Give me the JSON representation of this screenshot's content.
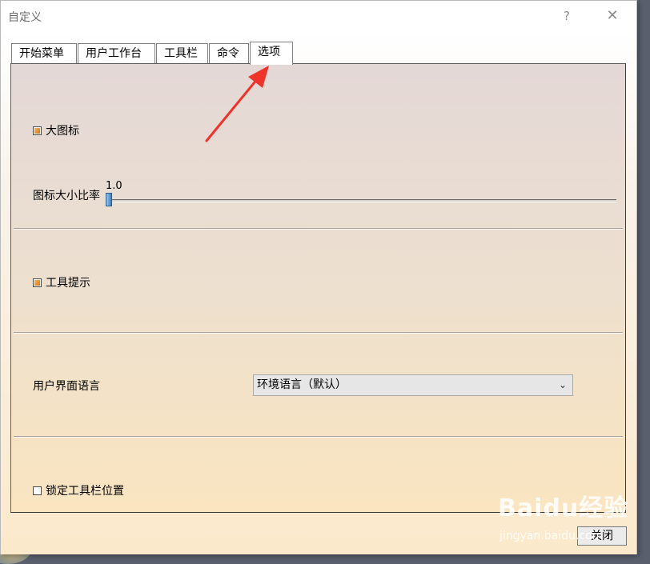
{
  "window": {
    "title": "自定义",
    "help_icon": "?",
    "close_icon": "✕"
  },
  "tabs": [
    {
      "label": "开始菜单"
    },
    {
      "label": "用户工作台"
    },
    {
      "label": "工具栏"
    },
    {
      "label": "命令"
    },
    {
      "label": "选项",
      "active": true
    }
  ],
  "options": {
    "large_icons": {
      "label": "大图标",
      "checked": true
    },
    "icon_scale": {
      "label": "图标大小比率",
      "value": "1.0"
    },
    "tooltips": {
      "label": "工具提示",
      "checked": true
    },
    "ui_language": {
      "label": "用户界面语言",
      "selected": "环境语言（默认）"
    },
    "lock_toolbar": {
      "label": "锁定工具栏位置",
      "checked": false
    }
  },
  "footer": {
    "close_label": "关闭"
  },
  "watermark": {
    "logo": "Baidu经验",
    "sub": "jingyan.baidu.com"
  },
  "colors": {
    "annotation_arrow": "#f0332a",
    "checkbox_fill": "#e08a2a"
  }
}
